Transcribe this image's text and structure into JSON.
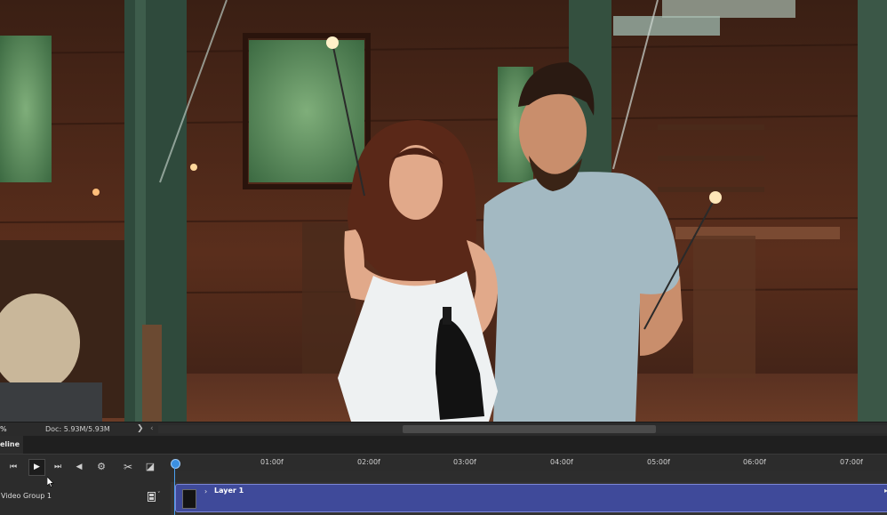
{
  "status": {
    "zoom": "%",
    "doc": "Doc: 5.93M/5.93M",
    "arrow": "❯",
    "scroll_left": "‹"
  },
  "timeline": {
    "tab_label": "eline",
    "controls": [
      {
        "name": "go-to-first-frame-icon",
        "glyph": "⏮"
      },
      {
        "name": "play-icon",
        "glyph": "▶"
      },
      {
        "name": "go-to-next-frame-icon",
        "glyph": "⏭"
      },
      {
        "name": "audio-icon",
        "glyph": "◀"
      },
      {
        "name": "settings-gear-icon",
        "glyph": "⚙"
      },
      {
        "name": "split-scissors-icon",
        "glyph": "✂"
      },
      {
        "name": "transition-icon",
        "glyph": "◪"
      }
    ],
    "ruler_ticks": [
      "01:00f",
      "02:00f",
      "03:00f",
      "04:00f",
      "05:00f",
      "06:00f",
      "07:00f"
    ],
    "track_name": "Video Group 1",
    "layer_name": "Layer 1",
    "chevron": "›",
    "film_menu": "˅"
  },
  "colors": {
    "clip": "#3f4a9a",
    "playhead": "#3b8fe0",
    "panel": "#2c2c2c"
  }
}
